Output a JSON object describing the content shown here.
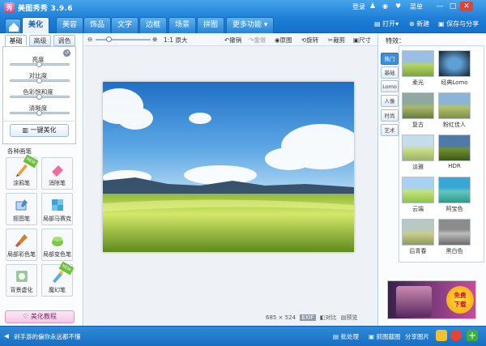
{
  "app": {
    "title": "美图秀秀 3.9.6"
  },
  "top_right": {
    "login": "登录",
    "menu": "菜单"
  },
  "main_tabs": [
    "美化",
    "美容",
    "饰品",
    "文字",
    "边框",
    "场景",
    "拼图",
    "更多功能"
  ],
  "top_actions": {
    "open": "打开",
    "new": "新建",
    "save": "保存与分享"
  },
  "left_tabs": [
    "基础",
    "高级",
    "调色"
  ],
  "sliders": [
    {
      "label": "亮度",
      "level": 0.5
    },
    {
      "label": "对比度",
      "level": 0.5
    },
    {
      "label": "色彩饱和度",
      "level": 0.5
    },
    {
      "label": "清晰度",
      "level": 0.5
    }
  ],
  "one_click_label": "一键美化",
  "tools_heading": "各种画笔",
  "tools": [
    {
      "label": "涂鸦笔",
      "badge": ""
    },
    {
      "label": "消除笔",
      "badge": ""
    },
    {
      "label": "抠图笔",
      "badge": ""
    },
    {
      "label": "局部马赛克",
      "badge": ""
    },
    {
      "label": "局部彩色笔",
      "badge": ""
    },
    {
      "label": "局部变色笔",
      "badge": ""
    },
    {
      "label": "背景虚化",
      "badge": ""
    },
    {
      "label": "魔幻笔",
      "badge": ""
    }
  ],
  "tutorial_label": "美化教程",
  "canvas_toolbar": {
    "zoom_label": "1:1 原大",
    "undo": "撤销",
    "redo": "重做",
    "original": "原图",
    "rotate": "旋转",
    "crop": "裁剪",
    "resize": "尺寸",
    "zoom_level": 0.25
  },
  "photo_footer": {
    "width": "685",
    "times": "×",
    "height": "524",
    "exif": "EXIF",
    "compare": "对比",
    "preview": "预览"
  },
  "right_panel": {
    "heading": "特效：",
    "tabs": [
      "热门",
      "基础",
      "Lomo",
      "人像",
      "时尚",
      "艺术"
    ],
    "effects": [
      "柔光",
      "经典Lomo",
      "复古",
      "粉红佳人",
      "淡雅",
      "HDR",
      "云端",
      "阿宝色",
      "后青春",
      "黑白色"
    ],
    "ad": {
      "line1": "免费",
      "line2": "下载"
    }
  },
  "statusbar": {
    "tip": "剁手游的偏你永远都不懂",
    "batch": "批处理",
    "screenshot": "抓图截图",
    "share": "分享图片"
  },
  "colors": {
    "title_bar": "#1f7fd6",
    "accent": "#3b8fdc",
    "tutorial": "#f5c7e6"
  }
}
